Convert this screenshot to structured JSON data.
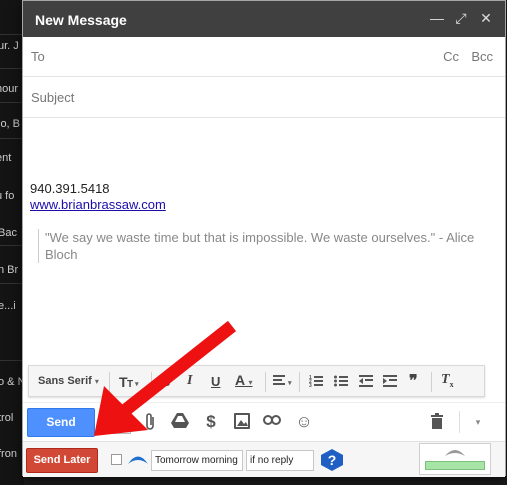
{
  "background": {
    "items": [
      "ur. J",
      "hour",
      "lo, B",
      "ent",
      "u fo",
      "Bac",
      "n Br",
      "e...i",
      "o & N",
      "trol",
      "fron"
    ]
  },
  "compose": {
    "title": "New Message",
    "controls": {
      "minimize": "—",
      "expand": "⤢",
      "close": "✕"
    },
    "to_label": "To",
    "cc_label": "Cc",
    "bcc_label": "Bcc",
    "subject_placeholder": "Subject",
    "body": {
      "phone": "940.391.5418",
      "website": "www.brianbrassaw.com",
      "quote": "\"We say we waste time but that is impossible. We waste ourselves.\" - Alice Bloch"
    }
  },
  "format_toolbar": {
    "font": "Sans Serif",
    "size_icon": "text-size-icon",
    "bold": "B",
    "italic": "I",
    "underline": "U",
    "text_color": "A",
    "align_icon": "align-icon",
    "numbered_list_icon": "numbered-list-icon",
    "bullet_list_icon": "bullet-list-icon",
    "indent_less_icon": "indent-less-icon",
    "indent_more_icon": "indent-more-icon",
    "quote_icon": "quote-icon",
    "clear_format_icon": "clear-formatting-icon"
  },
  "actions": {
    "send_label": "Send",
    "icons": [
      "format-icon",
      "attach-icon",
      "drive-icon",
      "money-icon",
      "photo-icon",
      "link-icon",
      "emoji-icon",
      "trash-icon",
      "more-options-icon"
    ]
  },
  "boomerang": {
    "send_later_label": "Send Later",
    "time_value": "Tomorrow morning",
    "reply_value": "if no reply",
    "help_icon": "help-icon"
  },
  "colors": {
    "titlebar": "#404040",
    "send": "#4d90fe",
    "send_later": "#d14836",
    "arrow": "#ee1111"
  }
}
